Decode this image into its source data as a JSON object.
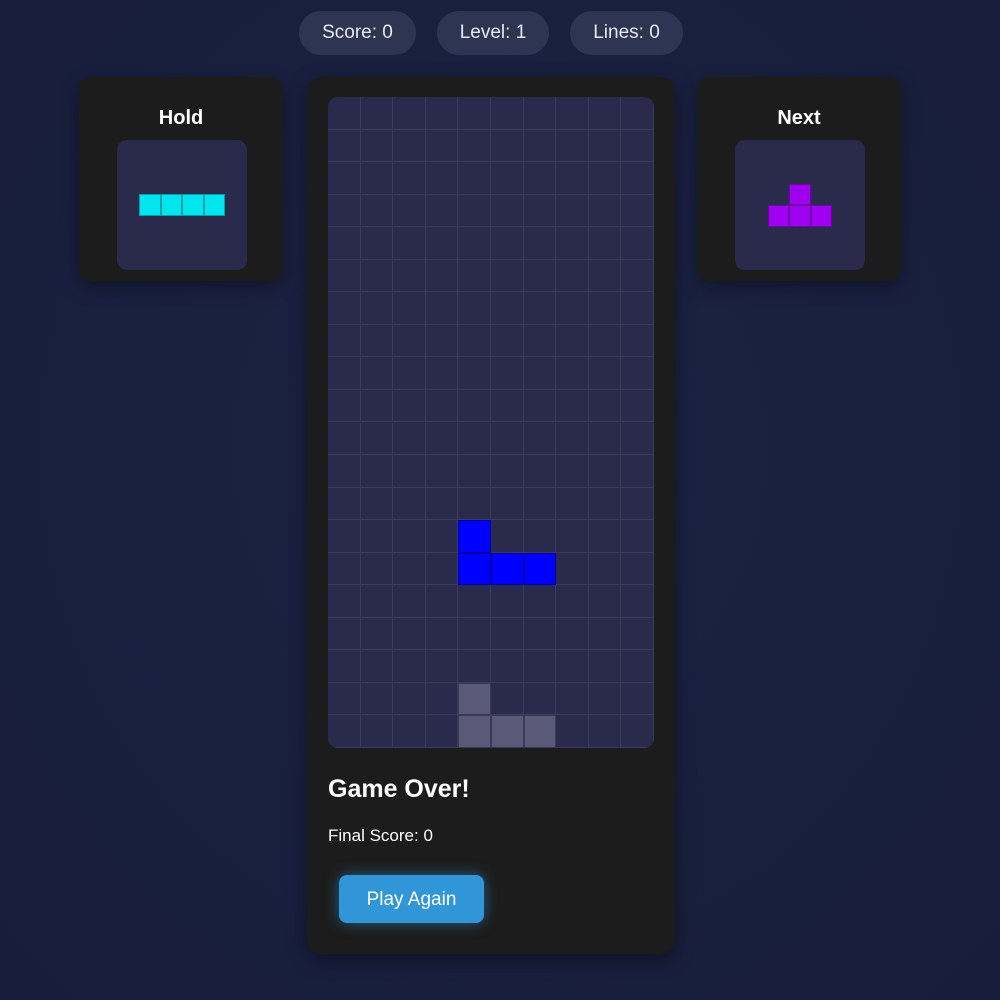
{
  "stats": {
    "score": "Score: 0",
    "level": "Level: 1",
    "lines": "Lines: 0"
  },
  "hold": {
    "title": "Hold",
    "piece": "I",
    "color": "#00e5ee",
    "cells": [
      [
        0,
        0
      ],
      [
        1,
        0
      ],
      [
        2,
        0
      ],
      [
        3,
        0
      ]
    ]
  },
  "next": {
    "title": "Next",
    "piece": "T",
    "color": "#a000f0",
    "cells": [
      [
        1,
        0
      ],
      [
        0,
        1
      ],
      [
        1,
        1
      ],
      [
        2,
        1
      ]
    ]
  },
  "board": {
    "columns": 10,
    "rows": 20,
    "colors": {
      "background": "#2a2b4c",
      "grid": "#3a3b5e",
      "active": "#0000ff",
      "ghost": "#5a5a78"
    },
    "active_piece": {
      "piece": "J",
      "cells": [
        [
          4,
          13
        ],
        [
          4,
          14
        ],
        [
          5,
          14
        ],
        [
          6,
          14
        ]
      ]
    },
    "ghost_piece": {
      "piece": "J",
      "cells": [
        [
          4,
          18
        ],
        [
          4,
          19
        ],
        [
          5,
          19
        ],
        [
          6,
          19
        ]
      ]
    }
  },
  "game_over": {
    "title": "Game Over!",
    "final_score_label": "Final Score:",
    "final_score_value": "0",
    "play_again_label": "Play Again"
  }
}
